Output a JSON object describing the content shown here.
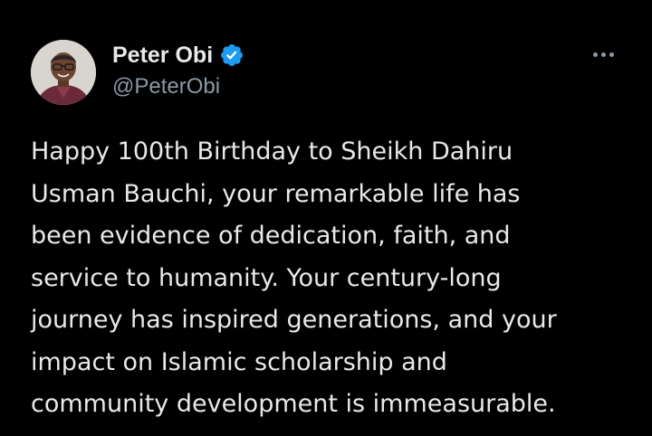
{
  "author": {
    "display_name": "Peter Obi",
    "handle": "@PeterObi",
    "verified": true,
    "verified_color": "#1d9bf0"
  },
  "tweet": {
    "lines": [
      "Happy 100th Birthday to Sheikh Dahiru",
      "Usman Bauchi, your remarkable life has",
      "been evidence of dedication, faith, and",
      "service to humanity. Your century-long",
      "journey has inspired generations, and your",
      "impact on Islamic scholarship and",
      "community development is immeasurable."
    ]
  },
  "icons": {
    "more": "more-horizontal-icon",
    "verified": "verified-badge-icon"
  },
  "colors": {
    "background": "#000000",
    "text": "#e7e9ea",
    "secondary_text": "#8b98a5"
  }
}
